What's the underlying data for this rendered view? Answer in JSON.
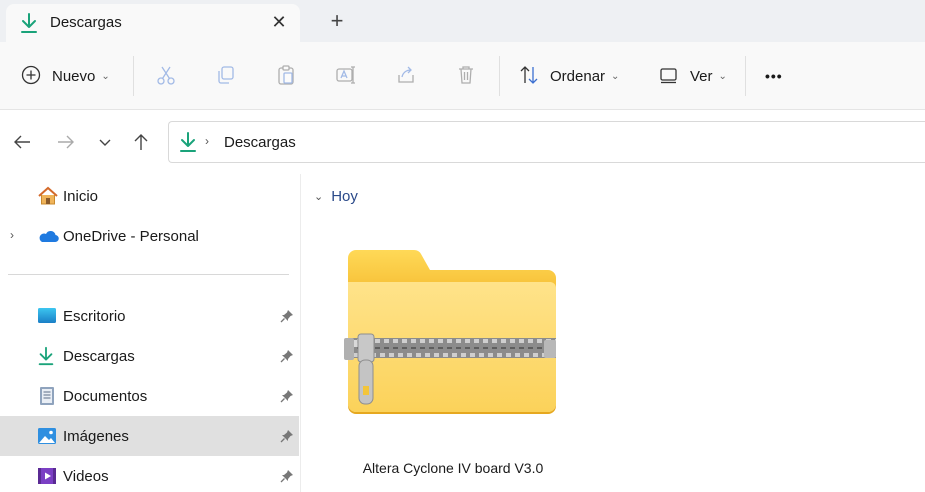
{
  "tab": {
    "title": "Descargas",
    "close_symbol": "✕",
    "new_tab_symbol": "+"
  },
  "toolbar": {
    "new_label": "Nuevo",
    "sort_label": "Ordenar",
    "view_label": "Ver",
    "more_symbol": "•••"
  },
  "address": {
    "separator": "›",
    "crumb": "Descargas"
  },
  "sidebar": {
    "items": [
      {
        "label": "Inicio",
        "icon": "home-icon"
      },
      {
        "label": "OneDrive - Personal",
        "icon": "onedrive-cloud-icon",
        "expand": "›"
      },
      {
        "label": "Escritorio",
        "icon": "desktop-icon",
        "pinned": true
      },
      {
        "label": "Descargas",
        "icon": "download-icon",
        "pinned": true
      },
      {
        "label": "Documentos",
        "icon": "documents-icon",
        "pinned": true
      },
      {
        "label": "Imágenes",
        "icon": "pictures-icon",
        "pinned": true,
        "selected": true
      },
      {
        "label": "Videos",
        "icon": "videos-icon",
        "pinned": true
      }
    ]
  },
  "content": {
    "group_label": "Hoy",
    "group_chevron": "⌄",
    "file": {
      "name": "Altera Cyclone IV board V3.0",
      "icon": "zip-folder-icon"
    }
  },
  "colors": {
    "accent_green": "#1aa37a",
    "folder_yellow": "#f8c94a",
    "link_blue": "#2b4a8a",
    "selected_bg": "#e0e0e0"
  }
}
